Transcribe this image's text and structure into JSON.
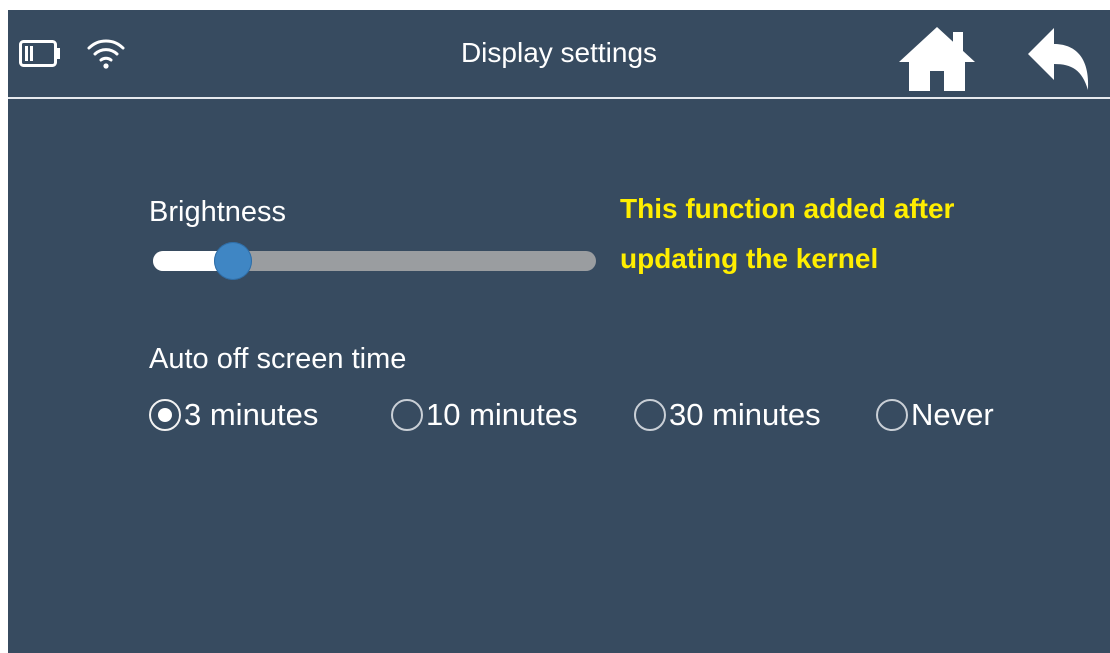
{
  "header": {
    "title": "Display settings",
    "status_icons": [
      "battery-icon",
      "wifi-icon"
    ],
    "actions": [
      "home-icon",
      "back-arrow-icon"
    ]
  },
  "brightness": {
    "label": "Brightness",
    "level": 0.18
  },
  "note": {
    "line1": "This function added after",
    "line2": "updating the kernel",
    "color": "#ffee00"
  },
  "auto_off": {
    "label": "Auto off screen time",
    "selected": "3 minutes",
    "options": [
      {
        "label": "3 minutes",
        "checked": true
      },
      {
        "label": "10 minutes",
        "checked": false
      },
      {
        "label": "30 minutes",
        "checked": false
      },
      {
        "label": "Never",
        "checked": false
      }
    ]
  },
  "colors": {
    "background": "#374b60",
    "slider_thumb": "#3f86c4",
    "slider_track": "#9a9da0",
    "note_text": "#ffee00"
  }
}
